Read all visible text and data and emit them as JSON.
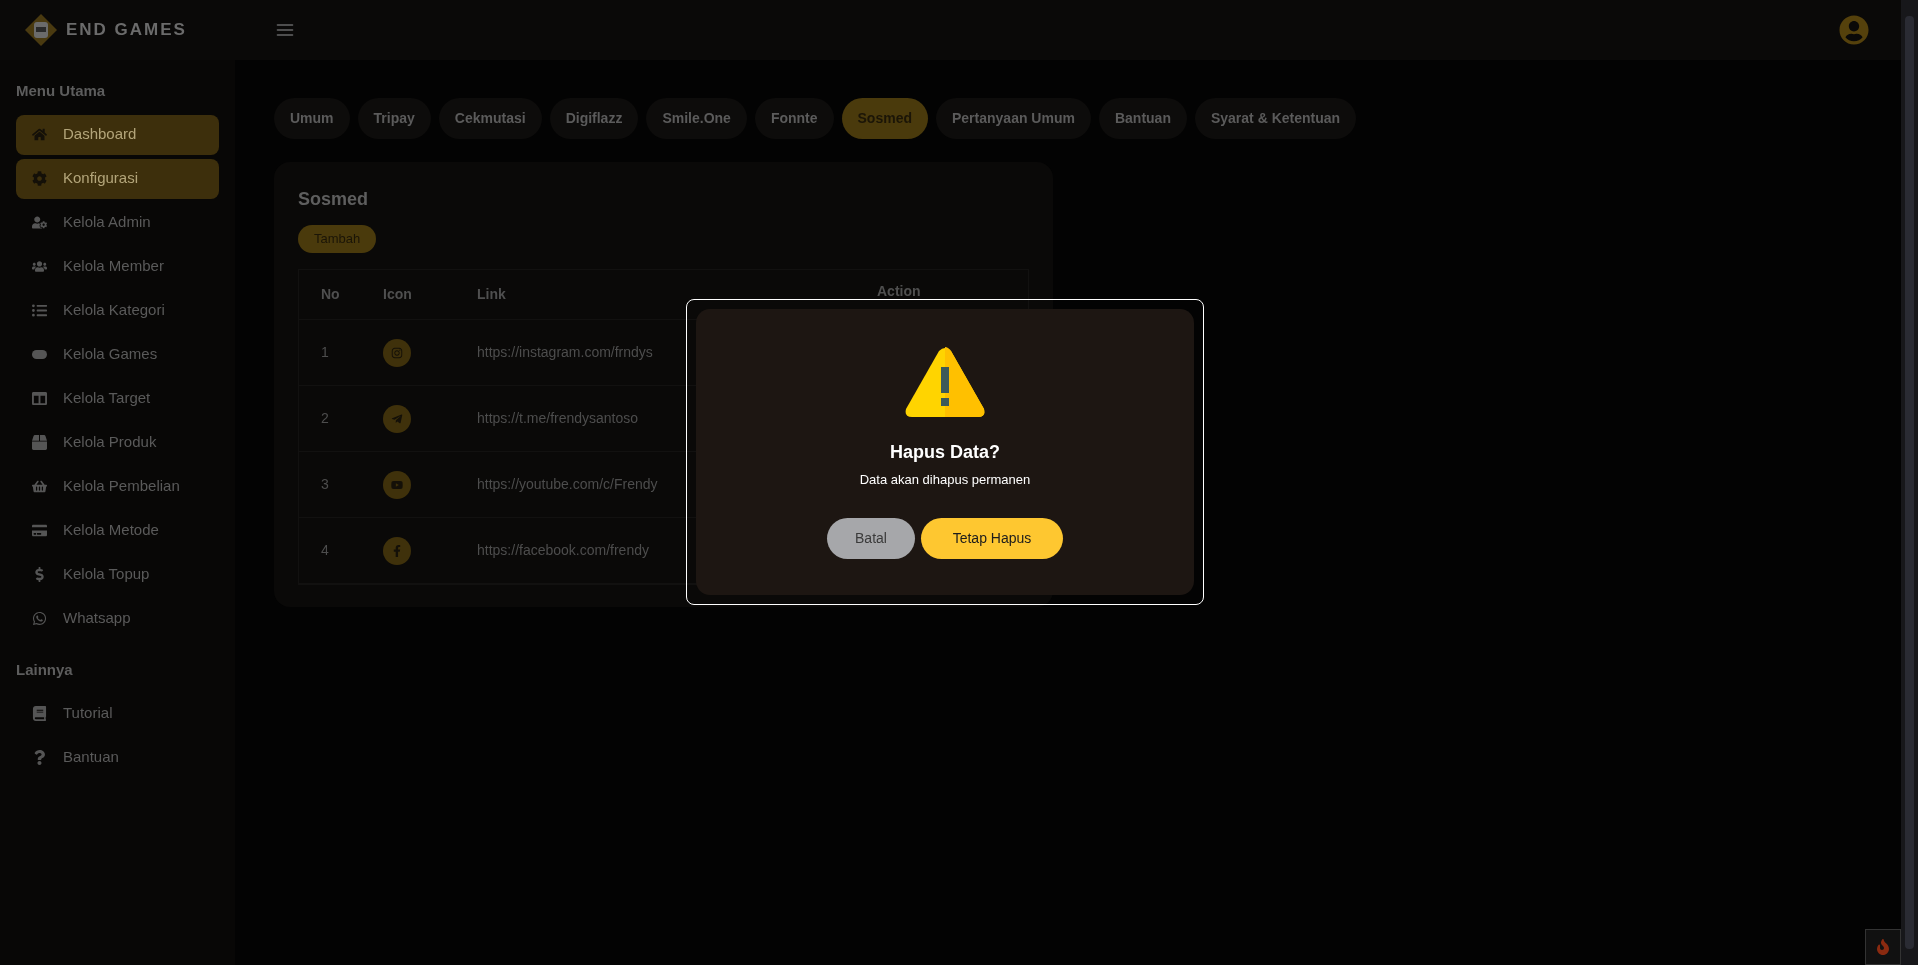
{
  "brand": {
    "name": "END GAMES"
  },
  "sidebar": {
    "sections": [
      {
        "title": "Menu Utama",
        "items": [
          {
            "label": "Dashboard",
            "selected": true
          },
          {
            "label": "Konfigurasi",
            "selected": true
          },
          {
            "label": "Kelola Admin",
            "selected": false
          },
          {
            "label": "Kelola Member",
            "selected": false
          },
          {
            "label": "Kelola Kategori",
            "selected": false
          },
          {
            "label": "Kelola Games",
            "selected": false
          },
          {
            "label": "Kelola Target",
            "selected": false
          },
          {
            "label": "Kelola Produk",
            "selected": false
          },
          {
            "label": "Kelola Pembelian",
            "selected": false
          },
          {
            "label": "Kelola Metode",
            "selected": false
          },
          {
            "label": "Kelola Topup",
            "selected": false
          },
          {
            "label": "Whatsapp",
            "selected": false
          }
        ]
      },
      {
        "title": "Lainnya",
        "items": [
          {
            "label": "Tutorial",
            "selected": false
          },
          {
            "label": "Bantuan",
            "selected": false
          }
        ]
      }
    ]
  },
  "tabs": [
    {
      "label": "Umum",
      "selected": false
    },
    {
      "label": "Tripay",
      "selected": false
    },
    {
      "label": "Cekmutasi",
      "selected": false
    },
    {
      "label": "Digiflazz",
      "selected": false
    },
    {
      "label": "Smile.One",
      "selected": false
    },
    {
      "label": "Fonnte",
      "selected": false
    },
    {
      "label": "Sosmed",
      "selected": true
    },
    {
      "label": "Pertanyaan Umum",
      "selected": false
    },
    {
      "label": "Bantuan",
      "selected": false
    },
    {
      "label": "Syarat & Ketentuan",
      "selected": false
    }
  ],
  "card": {
    "title": "Sosmed",
    "add_button": "Tambah",
    "table": {
      "columns": [
        "No",
        "Icon",
        "Link",
        "Action"
      ],
      "rows": [
        {
          "no": "1",
          "link": "https://instagram.com/frndys"
        },
        {
          "no": "2",
          "link": "https://t.me/frendysantoso"
        },
        {
          "no": "3",
          "link": "https://youtube.com/c/Frendy"
        },
        {
          "no": "4",
          "link": "https://facebook.com/frendy"
        }
      ]
    }
  },
  "dialog": {
    "title": "Hapus Data?",
    "message": "Data akan dihapus permanen",
    "buttons": [
      {
        "label": "Batal",
        "kind": "cancel"
      },
      {
        "label": "Tetap Hapus",
        "kind": "confirm"
      }
    ]
  }
}
